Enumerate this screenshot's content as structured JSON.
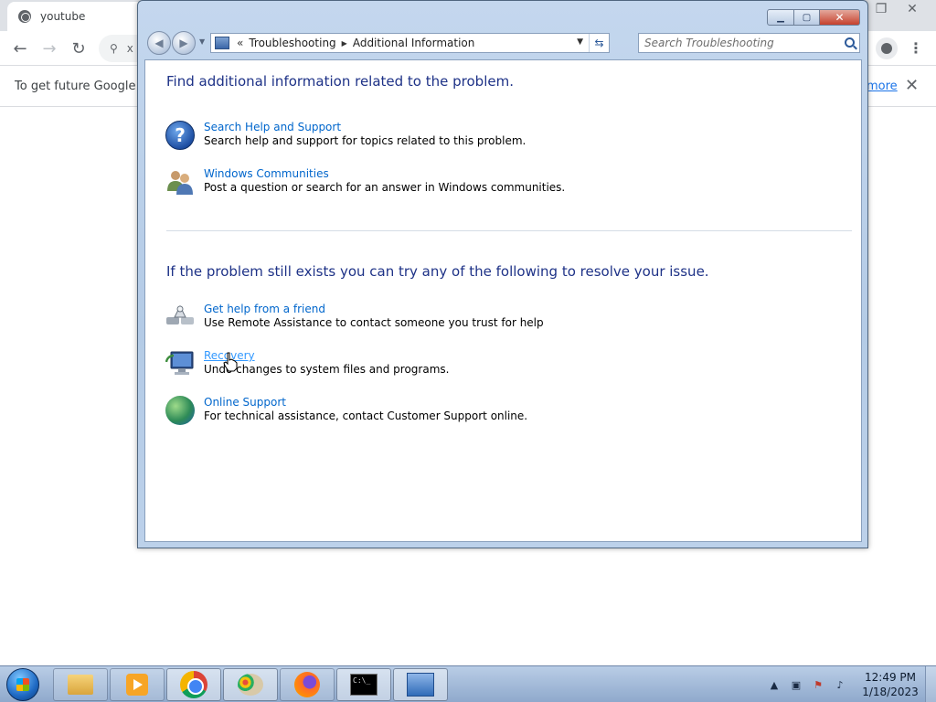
{
  "chrome": {
    "tab_title": "youtube",
    "omnibox_text": "x",
    "infobar_text": "To get future Google Ch",
    "infobar_link": "more"
  },
  "window": {
    "controls": [
      "minimize",
      "maximize",
      "close"
    ],
    "breadcrumb": [
      "Troubleshooting",
      "Additional Information"
    ],
    "search_placeholder": "Search Troubleshooting",
    "section1_heading": "Find additional information related to the problem.",
    "section1_items": [
      {
        "title": "Search Help and Support",
        "desc": "Search help and support for topics related to this problem.",
        "icon": "help-icon"
      },
      {
        "title": "Windows Communities",
        "desc": "Post a question or search for an answer in Windows communities.",
        "icon": "people-icon"
      }
    ],
    "section2_heading": "If the problem still exists you can try any of the following to resolve your issue.",
    "section2_items": [
      {
        "title": "Get help from a friend",
        "desc": "Use Remote Assistance to contact someone you trust for help",
        "icon": "remote-assistance-icon"
      },
      {
        "title": "Recovery",
        "desc": "Undo changes to system files and programs.",
        "icon": "recovery-icon"
      },
      {
        "title": "Online Support",
        "desc": "For technical assistance, contact Customer Support online.",
        "icon": "globe-icon"
      }
    ]
  },
  "taskbar": {
    "apps": [
      "Windows Explorer",
      "Windows Media Player",
      "Google Chrome",
      "Paint",
      "Firefox",
      "Command Prompt",
      "Control Panel"
    ],
    "clock_time": "12:49 PM",
    "clock_date": "1/18/2023"
  },
  "colors": {
    "heading": "#1e3287",
    "link": "#0066cc",
    "window_frame": "#b4cbe6"
  }
}
